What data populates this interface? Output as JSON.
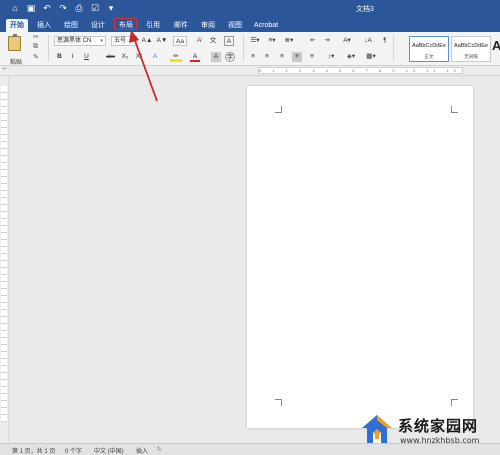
{
  "window": {
    "title": "文档3"
  },
  "quick_access": [
    "home-icon",
    "save-icon",
    "undo-icon",
    "redo-icon",
    "print-icon",
    "check-icon",
    "more-icon"
  ],
  "tabs": [
    {
      "label": "开始",
      "active": true
    },
    {
      "label": "插入"
    },
    {
      "label": "绘图"
    },
    {
      "label": "设计"
    },
    {
      "label": "布局"
    },
    {
      "label": "引用"
    },
    {
      "label": "邮件"
    },
    {
      "label": "审阅"
    },
    {
      "label": "视图"
    },
    {
      "label": "Acrobat"
    }
  ],
  "ribbon": {
    "paste_label": "粘贴",
    "font_name": "思源黑体 CN",
    "font_size": "五号",
    "bold": "B",
    "italic": "I",
    "underline": "U",
    "strike": "abc",
    "subscript": "X₂",
    "superscript": "X²",
    "grow_font": "A▲",
    "shrink_font": "A▼",
    "case": "Aa",
    "font_color": "A",
    "styles": [
      {
        "sample": "AaBbCcDdEe",
        "name": "正文",
        "selected": true
      },
      {
        "sample": "AaBbCcDdEe",
        "name": "无间隔"
      }
    ],
    "big_style_sample": "A"
  },
  "ruler_numbers": "2 1 1 2 3 4 5 6 7 8 9 10 11 12 13 14 15 16 17 18",
  "status": {
    "page": "第 1 页，共 1 页",
    "words": "0 个字",
    "language": "中文 (中国)",
    "mode": "插入"
  },
  "watermark": {
    "text": "系统家园网",
    "url": "www.hnzkhbsb.com"
  },
  "colors": {
    "accent": "#2b579a",
    "highlight_box": "#e0302c",
    "arrow": "#c8262b"
  }
}
